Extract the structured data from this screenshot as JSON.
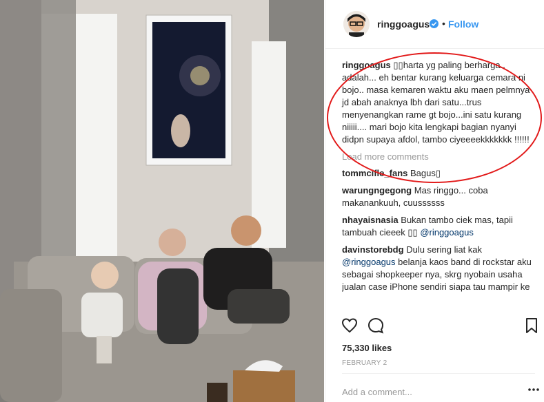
{
  "post": {
    "username": "ringgoagus",
    "separator": "•",
    "follow_label": "Follow",
    "caption": {
      "user": "ringgoagus",
      "text": "▯▯harta yg paling berharga.. adalah... eh bentar kurang keluarga cemara ni bojo.. masa kemaren waktu aku maen pelmnya jd abah anaknya lbh dari satu...trus menyenangkan rame gt bojo...ini satu kurang niiiii.... mari bojo kita lengkapi bagian nyanyi didpn supaya afdol, tambo ciyeeeekkkkkkk !!!!!!"
    },
    "load_more": "Load more comments",
    "comments": [
      {
        "user": "tommcifle_fans",
        "text": "Bagus▯"
      },
      {
        "user": "warungngegong",
        "text": "Mas ringgo... coba makanankuuh, cuussssss"
      },
      {
        "user": "nhayaisnasia",
        "text": "Bukan tambo ciek mas, tapii tambuah cieeek ▯▯ ",
        "mention": "@ringgoagus"
      },
      {
        "user": "davinstorebdg",
        "text": "Dulu sering liat kak ",
        "mention": "@ringgoagus",
        "text2": " belanja kaos band di rockstar aku sebagai shopkeeper nya, skrg nyobain usaha jualan case iPhone sendiri siapa tau mampir ke ig aja #produsijualan #tasgagan"
      }
    ],
    "likes": "75,330 likes",
    "date": "FEBRUARY 2",
    "add_comment_placeholder": "Add a comment...",
    "icons": {
      "verified": "verified-badge-icon",
      "like": "heart-icon",
      "comment": "speech-bubble-icon",
      "save": "bookmark-icon",
      "more": "more-options-icon"
    },
    "colors": {
      "follow": "#3897f0",
      "verified": "#3897f0",
      "annotation_circle": "#e21a1a"
    }
  }
}
